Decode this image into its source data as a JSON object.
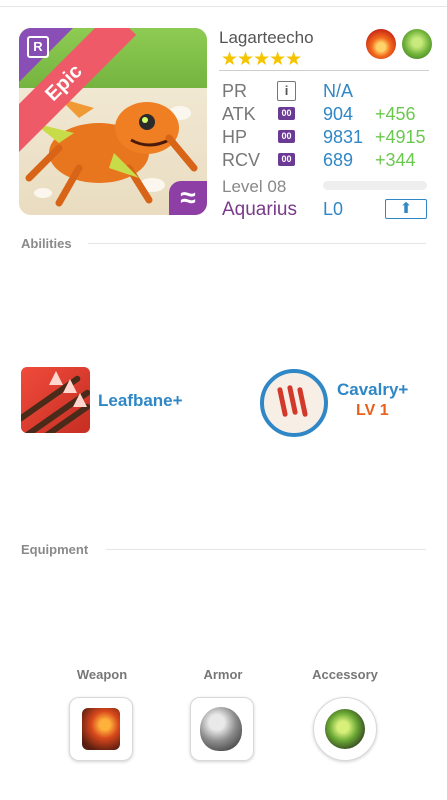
{
  "monster": {
    "name": "Lagarteecho",
    "rarity": "Epic",
    "rank_badge": "R",
    "element_symbol": "≈",
    "stars": "★★★★★",
    "elements": [
      "fire-icon",
      "leaf-icon"
    ]
  },
  "stats": {
    "pr": {
      "label": "PR",
      "info": "i",
      "value": "N/A"
    },
    "atk": {
      "label": "ATK",
      "pill": "00",
      "value": "904",
      "bonus": "+456"
    },
    "hp": {
      "label": "HP",
      "pill": "00",
      "value": "9831",
      "bonus": "+4915"
    },
    "rcv": {
      "label": "RCV",
      "pill": "00",
      "value": "689",
      "bonus": "+344"
    },
    "level_label": "Level 08",
    "level_progress": 0,
    "sign": "Aquarius",
    "limit": "L0",
    "upgrade_icon": "⬆"
  },
  "sections": {
    "abilities": "Abilities",
    "equipment": "Equipment"
  },
  "abilities": [
    {
      "name": "Leafbane+",
      "icon": "leafbane-icon"
    },
    {
      "name": "Cavalry+",
      "level": "LV 1",
      "icon": "cavalry-icon"
    }
  ],
  "equipment": {
    "weapon": "Weapon",
    "armor": "Armor",
    "accessory": "Accessory"
  },
  "colors": {
    "accent_blue": "#2f87c6",
    "bonus_green": "#6bc84e",
    "epic_red": "#ee5a67",
    "aquarius_purple": "#7a3a8a",
    "level_orange": "#e8601c"
  }
}
